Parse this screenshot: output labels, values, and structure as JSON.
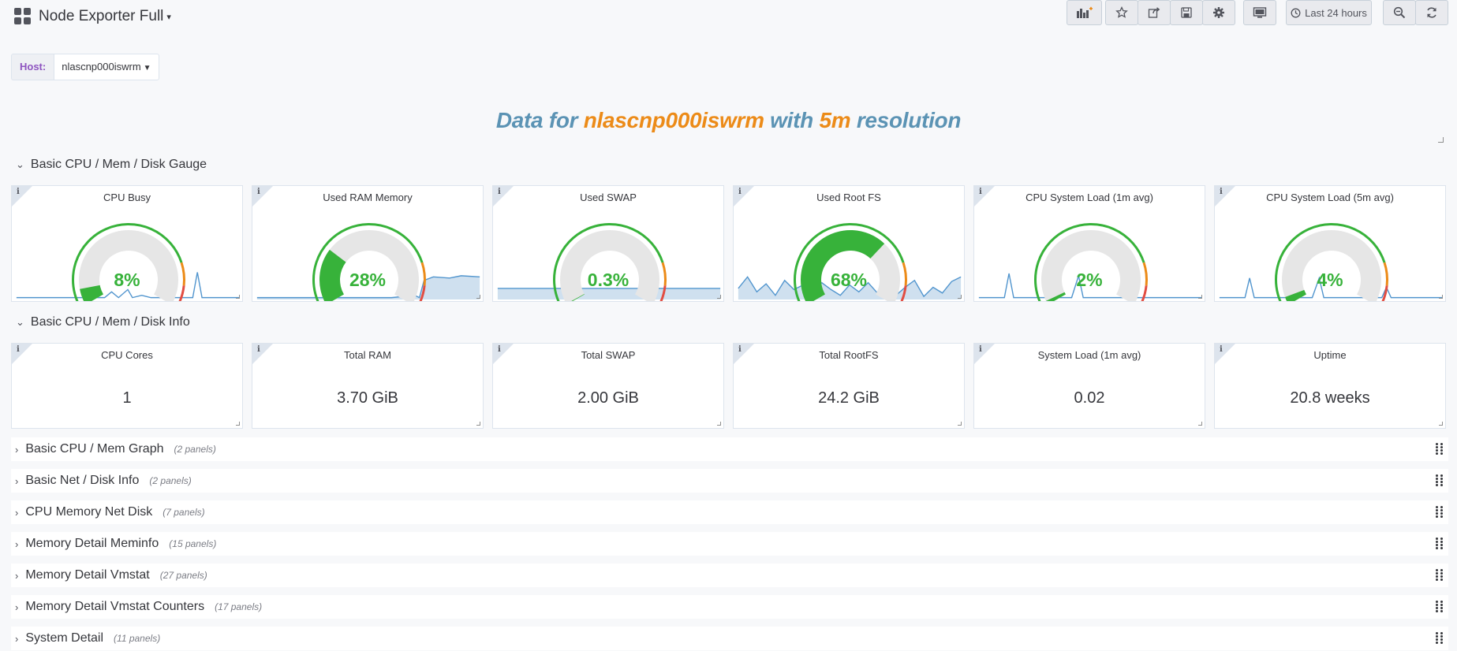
{
  "navbar": {
    "title": "Node Exporter Full",
    "time_range": "Last 24 hours"
  },
  "variable": {
    "label": "Host:",
    "value": "nlascnp000iswrm"
  },
  "headline": {
    "prefix": "Data for",
    "host": "nlascnp000iswrm",
    "mid": "with",
    "resolution": "5m",
    "suffix": "resolution"
  },
  "colors": {
    "ok": "#37b23a",
    "warn": "#ec8b18",
    "crit": "#e24d42",
    "spark": "#5195ce"
  },
  "rows": {
    "gauge_row": "Basic CPU / Mem / Disk Gauge",
    "info_row": "Basic CPU / Mem / Disk Info"
  },
  "gauges": [
    {
      "title": "CPU Busy",
      "value": "8%",
      "fraction": 0.08
    },
    {
      "title": "Used RAM Memory",
      "value": "28%",
      "fraction": 0.28
    },
    {
      "title": "Used SWAP",
      "value": "0.3%",
      "fraction": 0.003
    },
    {
      "title": "Used Root FS",
      "value": "68%",
      "fraction": 0.68
    },
    {
      "title": "CPU System Load (1m avg)",
      "value": "2%",
      "fraction": 0.02
    },
    {
      "title": "CPU System Load (5m avg)",
      "value": "4%",
      "fraction": 0.04
    }
  ],
  "stats": [
    {
      "title": "CPU Cores",
      "value": "1"
    },
    {
      "title": "Total RAM",
      "value": "3.70 GiB"
    },
    {
      "title": "Total SWAP",
      "value": "2.00 GiB"
    },
    {
      "title": "Total RootFS",
      "value": "24.2 GiB"
    },
    {
      "title": "System Load (1m avg)",
      "value": "0.02"
    },
    {
      "title": "Uptime",
      "value": "20.8 weeks"
    }
  ],
  "collapsed_rows": [
    {
      "title": "Basic CPU / Mem Graph",
      "count": "(2 panels)"
    },
    {
      "title": "Basic Net / Disk Info",
      "count": "(2 panels)"
    },
    {
      "title": "CPU Memory Net Disk",
      "count": "(7 panels)"
    },
    {
      "title": "Memory Detail Meminfo",
      "count": "(15 panels)"
    },
    {
      "title": "Memory Detail Vmstat",
      "count": "(27 panels)"
    },
    {
      "title": "Memory Detail Vmstat Counters",
      "count": "(17 panels)"
    },
    {
      "title": "System Detail",
      "count": "(11 panels)"
    }
  ]
}
